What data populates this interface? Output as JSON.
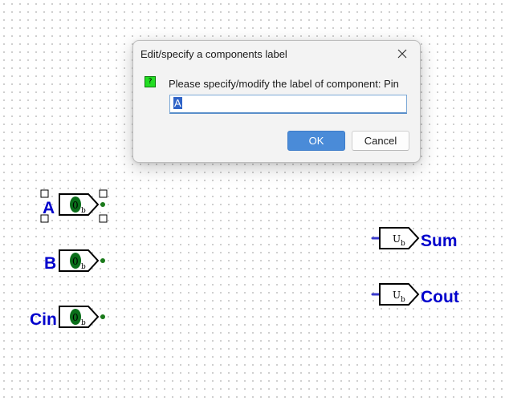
{
  "dialog": {
    "title": "Edit/specify a components label",
    "prompt": "Please specify/modify the label of component: Pin",
    "input_value": "A",
    "ok_label": "OK",
    "cancel_label": "Cancel",
    "question_glyph": "?"
  },
  "circuit": {
    "inputs": [
      {
        "label": "A",
        "value": "0",
        "sub": "b",
        "selected": true
      },
      {
        "label": "B",
        "value": "0",
        "sub": "b",
        "selected": false
      },
      {
        "label": "Cin",
        "value": "0",
        "sub": "b",
        "selected": false
      }
    ],
    "outputs": [
      {
        "label": "Sum",
        "value": "U",
        "sub": "b"
      },
      {
        "label": "Cout",
        "value": "U",
        "sub": "b"
      }
    ]
  },
  "colors": {
    "label": "#0000cc",
    "input_value_fill": "#0a6e1a",
    "input_wire_dot": "#1a7a1a",
    "output_wire": "#3a3acd",
    "selection_handle": "#000000"
  }
}
